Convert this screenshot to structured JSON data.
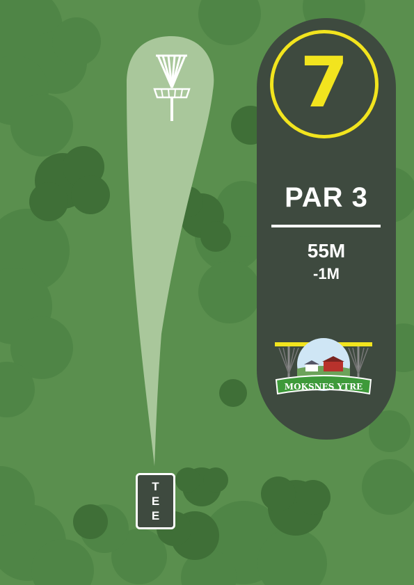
{
  "hole": {
    "number": "7"
  },
  "par": {
    "label": "PAR 3"
  },
  "distance": {
    "primary": "55M",
    "secondary": "-1M"
  },
  "logo": {
    "text": "MOKSNES YTRE"
  },
  "tee": {
    "letters": [
      "T",
      "E",
      "E"
    ]
  },
  "colors": {
    "grass": "#5a8f4e",
    "tree_light": "#4f8546",
    "tree_dark": "#3f6f37",
    "panel": "#3e4a3f",
    "accent": "#f2e41e",
    "fairway": "#a9c79b"
  },
  "icons": {
    "basket": "disc-golf-basket-icon"
  }
}
